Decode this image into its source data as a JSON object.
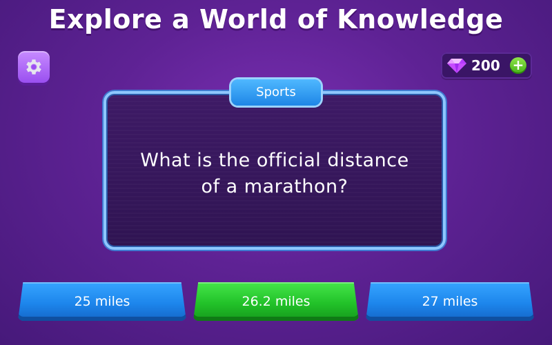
{
  "header": {
    "title": "Explore a World of Knowledge"
  },
  "settings": {
    "icon": "gear-icon"
  },
  "currency": {
    "icon": "gem-icon",
    "amount": "200",
    "add_icon": "plus-icon",
    "add_label": "+"
  },
  "question": {
    "category": "Sports",
    "text_line1": "What is the official distance",
    "text_line2": "of a marathon?"
  },
  "answers": [
    {
      "label": "25 miles",
      "color": "#1d86ec"
    },
    {
      "label": "26.2 miles",
      "color": "#22c229"
    },
    {
      "label": "27 miles",
      "color": "#1d86ec"
    }
  ],
  "colors": {
    "background": "#5e2294",
    "card_border": "#8ec7ff",
    "accent_blue": "#1d86ec",
    "correct_green": "#22c229"
  }
}
